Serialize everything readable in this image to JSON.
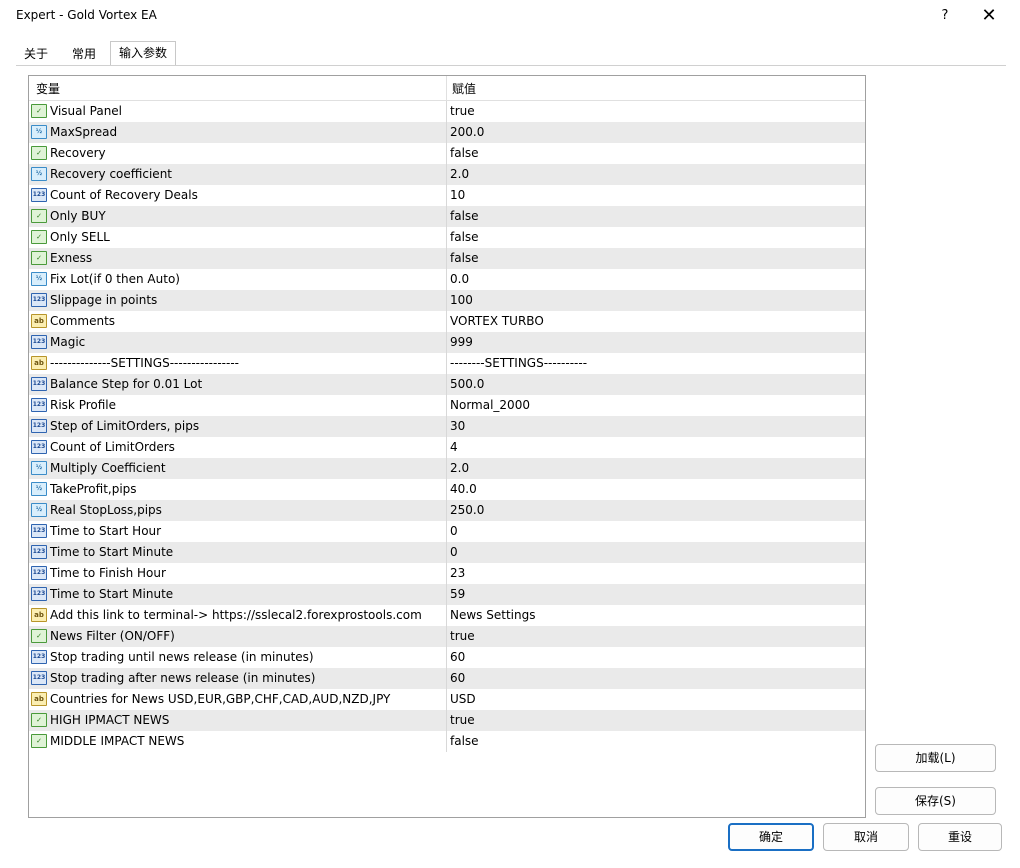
{
  "window": {
    "title": "Expert - Gold Vortex EA",
    "help_label": "?",
    "close_label": "✕"
  },
  "tabs": [
    {
      "label": "关于",
      "active": false
    },
    {
      "label": "常用",
      "active": false
    },
    {
      "label": "输入参数",
      "active": true
    }
  ],
  "table": {
    "col_variable": "变量",
    "col_value": "赋值",
    "rows": [
      {
        "type": "bool",
        "name": "Visual Panel",
        "value": "true"
      },
      {
        "type": "double",
        "name": "MaxSpread",
        "value": "200.0"
      },
      {
        "type": "bool",
        "name": "Recovery",
        "value": "false"
      },
      {
        "type": "double",
        "name": "Recovery coefficient",
        "value": "2.0"
      },
      {
        "type": "int",
        "name": "Count of Recovery Deals",
        "value": "10"
      },
      {
        "type": "bool",
        "name": "Only BUY",
        "value": "false"
      },
      {
        "type": "bool",
        "name": "Only SELL",
        "value": "false"
      },
      {
        "type": "bool",
        "name": "Exness",
        "value": "false"
      },
      {
        "type": "double",
        "name": "Fix Lot(if 0 then Auto)",
        "value": "0.0"
      },
      {
        "type": "int",
        "name": "Slippage in points",
        "value": "100"
      },
      {
        "type": "string",
        "name": "Comments",
        "value": "VORTEX TURBO"
      },
      {
        "type": "int",
        "name": "Magic",
        "value": "999"
      },
      {
        "type": "string",
        "name": "--------------SETTINGS----------------",
        "value": "--------SETTINGS----------"
      },
      {
        "type": "int",
        "name": "Balance Step for 0.01 Lot",
        "value": "500.0"
      },
      {
        "type": "int",
        "name": "Risk Profile",
        "value": "Normal_2000"
      },
      {
        "type": "int",
        "name": "Step of LimitOrders, pips",
        "value": "30"
      },
      {
        "type": "int",
        "name": "Count of LimitOrders",
        "value": "4"
      },
      {
        "type": "double",
        "name": "Multiply Coefficient",
        "value": "2.0"
      },
      {
        "type": "double",
        "name": "TakeProfit,pips",
        "value": "40.0"
      },
      {
        "type": "double",
        "name": "Real StopLoss,pips",
        "value": "250.0"
      },
      {
        "type": "int",
        "name": "Time to Start Hour",
        "value": "0"
      },
      {
        "type": "int",
        "name": "Time to Start Minute",
        "value": "0"
      },
      {
        "type": "int",
        "name": "Time to Finish Hour",
        "value": "23"
      },
      {
        "type": "int",
        "name": "Time to Start Minute",
        "value": "59"
      },
      {
        "type": "string",
        "name": "Add this link to terminal-> https://sslecal2.forexprostools.com",
        "value": "News Settings"
      },
      {
        "type": "bool",
        "name": "News Filter (ON/OFF)",
        "value": "true"
      },
      {
        "type": "int",
        "name": "Stop trading until news release (in minutes)",
        "value": "60"
      },
      {
        "type": "int",
        "name": "Stop trading after news release (in minutes)",
        "value": "60"
      },
      {
        "type": "string",
        "name": "Countries for News USD,EUR,GBP,CHF,CAD,AUD,NZD,JPY",
        "value": "USD"
      },
      {
        "type": "bool",
        "name": "HIGH IPMACT NEWS",
        "value": "true"
      },
      {
        "type": "bool",
        "name": "MIDDLE IMPACT NEWS",
        "value": "false"
      }
    ]
  },
  "buttons": {
    "load": "加载(L)",
    "save": "保存(S)",
    "ok": "确定",
    "cancel": "取消",
    "reset": "重设"
  },
  "icons": {
    "bool": "bool-icon",
    "double": "double-icon",
    "int": "int-icon",
    "string": "string-icon"
  },
  "colors": {
    "accent": "#1a6fc4",
    "row_alt": "#eaeaea"
  }
}
